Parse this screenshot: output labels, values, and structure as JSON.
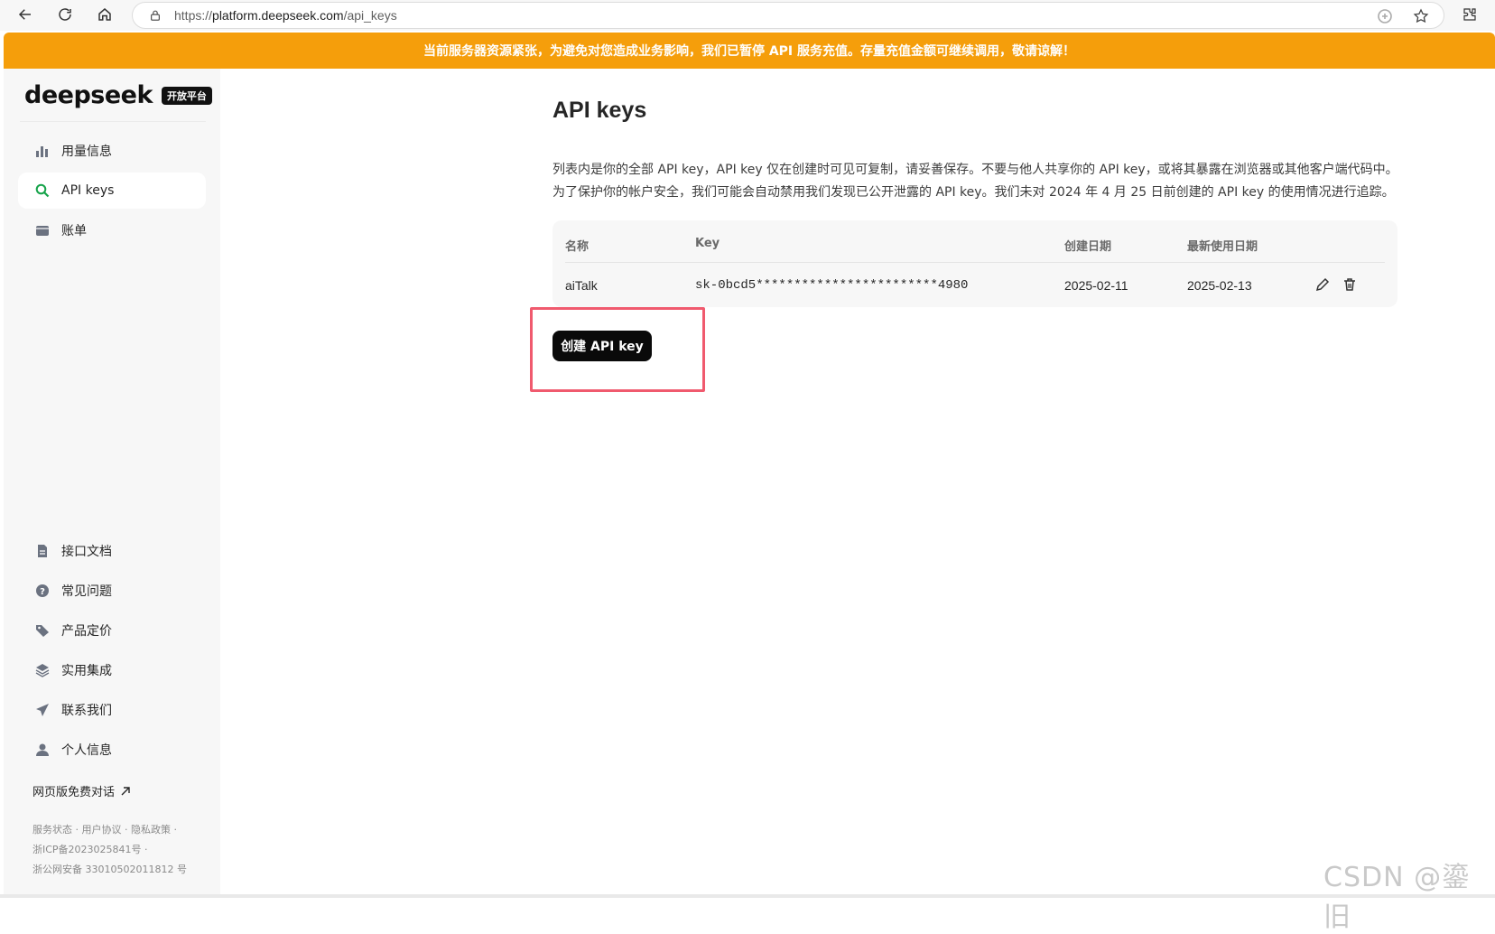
{
  "browser": {
    "url_prefix": "https://",
    "url_host": "platform.deepseek.com",
    "url_path": "/api_keys"
  },
  "banner": {
    "text": "当前服务器资源紧张，为避免对您造成业务影响，我们已暂停 API 服务充值。存量充值金额可继续调用，敬请谅解！"
  },
  "sidebar": {
    "logo_text": "deepseek",
    "logo_badge": "开放平台",
    "top_items": [
      {
        "label": "用量信息",
        "icon": "bar-chart-icon"
      },
      {
        "label": "API keys",
        "icon": "search-icon",
        "active": true
      },
      {
        "label": "账单",
        "icon": "wallet-icon"
      }
    ],
    "bottom_items": [
      {
        "label": "接口文档",
        "icon": "document-icon"
      },
      {
        "label": "常见问题",
        "icon": "question-icon"
      },
      {
        "label": "产品定价",
        "icon": "price-tag-icon"
      },
      {
        "label": "实用集成",
        "icon": "layers-icon"
      },
      {
        "label": "联系我们",
        "icon": "send-icon"
      },
      {
        "label": "个人信息",
        "icon": "user-icon"
      }
    ],
    "web_chat_label": "网页版免费对话",
    "footer_links": "服务状态 · 用户协议 · 隐私政策 ·",
    "icp": "浙ICP备2023025841号 ·",
    "police": "浙公网安备 33010502011812 号"
  },
  "main": {
    "title": "API keys",
    "desc_line1": "列表内是你的全部 API key，API key 仅在创建时可见可复制，请妥善保存。不要与他人共享你的 API key，或将其暴露在浏览器或其他客户端代码中。",
    "desc_line2": "为了保护你的帐户安全，我们可能会自动禁用我们发现已公开泄露的 API key。我们未对 2024 年 4 月 25 日前创建的 API key 的使用情况进行追踪。",
    "table": {
      "headers": {
        "name": "名称",
        "key": "Key",
        "created": "创建日期",
        "last_used": "最新使用日期"
      },
      "rows": [
        {
          "name": "aiTalk",
          "key": "sk-0bcd5************************4980",
          "created": "2025-02-11",
          "last_used": "2025-02-13"
        }
      ]
    },
    "create_button": "创建 API key"
  },
  "watermark": "CSDN @鎏旧"
}
